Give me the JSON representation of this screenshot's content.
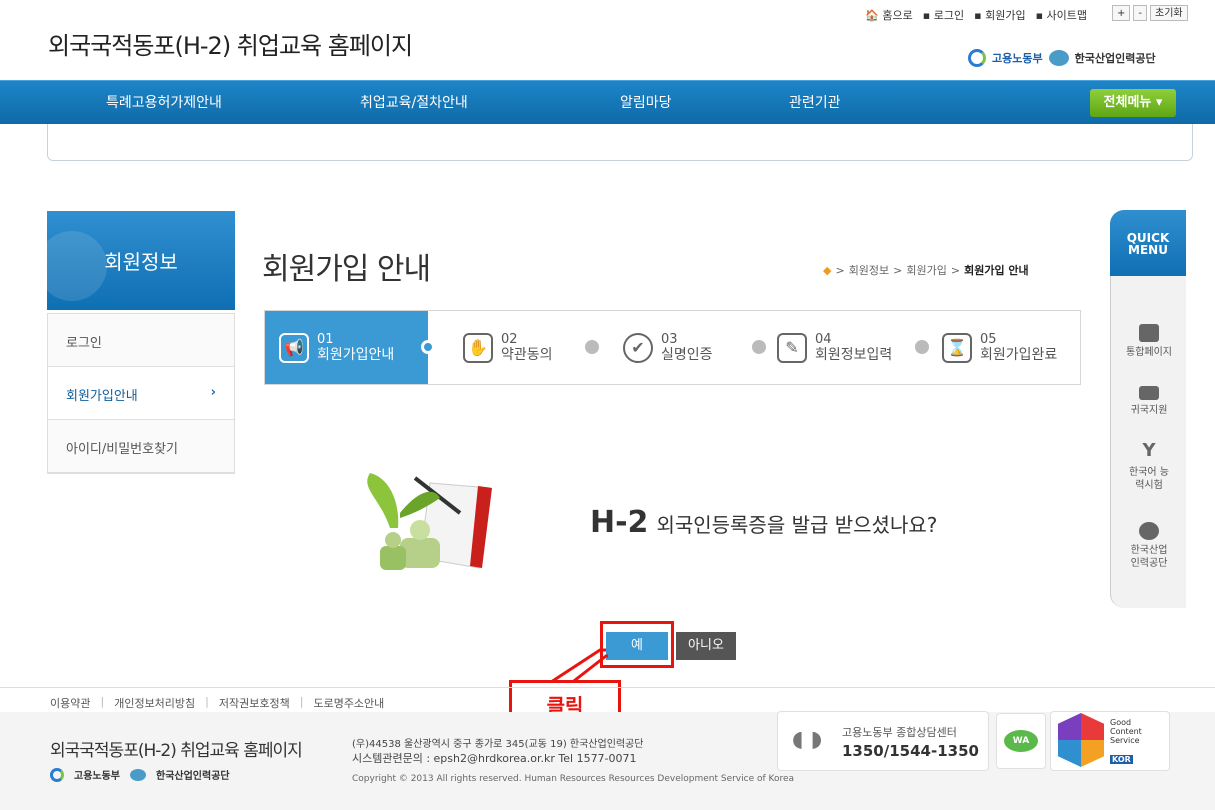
{
  "header": {
    "site_title": "외국국적동포(H-2) 취업교육 홈페이지",
    "top_links": [
      "홈으로",
      "로그인",
      "회원가입",
      "사이트맵"
    ],
    "font_buttons": [
      "+",
      "-",
      "초기화"
    ],
    "gov_logo_1": "고용노동부",
    "gov_logo_2": "한국산업인력공단"
  },
  "gnb": {
    "items": [
      "특례고용허가제안내",
      "취업교육/절차안내",
      "알림마당",
      "관련기관"
    ],
    "all_menu": "전체메뉴 ▾"
  },
  "lnb": {
    "title": "회원정보",
    "items": [
      "로그인",
      "회원가입안내",
      "아이디/비밀번호찾기"
    ],
    "active_arrow": "›"
  },
  "page": {
    "title": "회원가입 안내",
    "breadcrumb": [
      "회원정보",
      "회원가입",
      "회원가입 안내"
    ],
    "steps": [
      {
        "num": "01",
        "label": "회원가입안내"
      },
      {
        "num": "02",
        "label": "약관동의"
      },
      {
        "num": "03",
        "label": "실명인증"
      },
      {
        "num": "04",
        "label": "회원정보입력"
      },
      {
        "num": "05",
        "label": "회원가입완료"
      }
    ],
    "question_strong": "H-2",
    "question_text": "외국인등록증을 발급 받으셨나요?",
    "yes_label": "예",
    "no_label": "아니오",
    "callout": "클릭"
  },
  "quick": {
    "title_1": "QUICK",
    "title_2": "MENU",
    "items": [
      "통합페이지",
      "귀국지원",
      "한국어 능력시험",
      "한국산업 인력공단"
    ]
  },
  "footer": {
    "links": [
      "이용약관",
      "개인정보처리방침",
      "저작권보호정책",
      "도로명주소안내"
    ],
    "title": "외국국적동포(H-2) 취업교육 홈페이지",
    "address": "(우)44538 울산광역시 중구 종가로 345(교동 19) 한국산업인력공단",
    "contact": "시스템관련문의 : epsh2@hrdkorea.or.kr  Tel 1577-0071",
    "copyright": "Copyright © 2013 All rights reserved. Human Resources Resources Development Service of Korea",
    "logo_1": "고용노동부",
    "logo_2": "한국산업인력공단",
    "call_title": "고용노동부 종합상담센터",
    "call_number": "1350/1544-1350",
    "wa_label": "WA",
    "gc_text": "Good Content Service",
    "gc_kor": "KOR"
  }
}
